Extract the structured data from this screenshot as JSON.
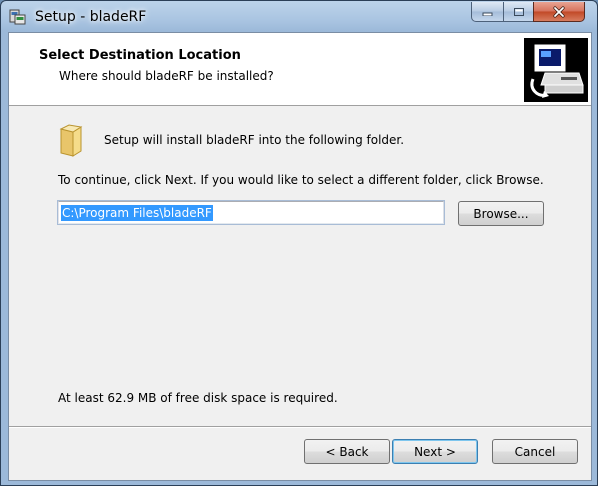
{
  "window": {
    "title": "Setup - bladeRF"
  },
  "header": {
    "title": "Select Destination Location",
    "subtitle": "Where should bladeRF be installed?"
  },
  "content": {
    "install_text": "Setup will install bladeRF into the following folder.",
    "instruction_text": "To continue, click Next. If you would like to select a different folder, click Browse.",
    "path_value": "C:\\Program Files\\bladeRF",
    "browse_label": "Browse...",
    "disk_space_text": "At least 62.9 MB of free disk space is required."
  },
  "footer": {
    "back_label": "< Back",
    "next_label": "Next >",
    "cancel_label": "Cancel"
  }
}
